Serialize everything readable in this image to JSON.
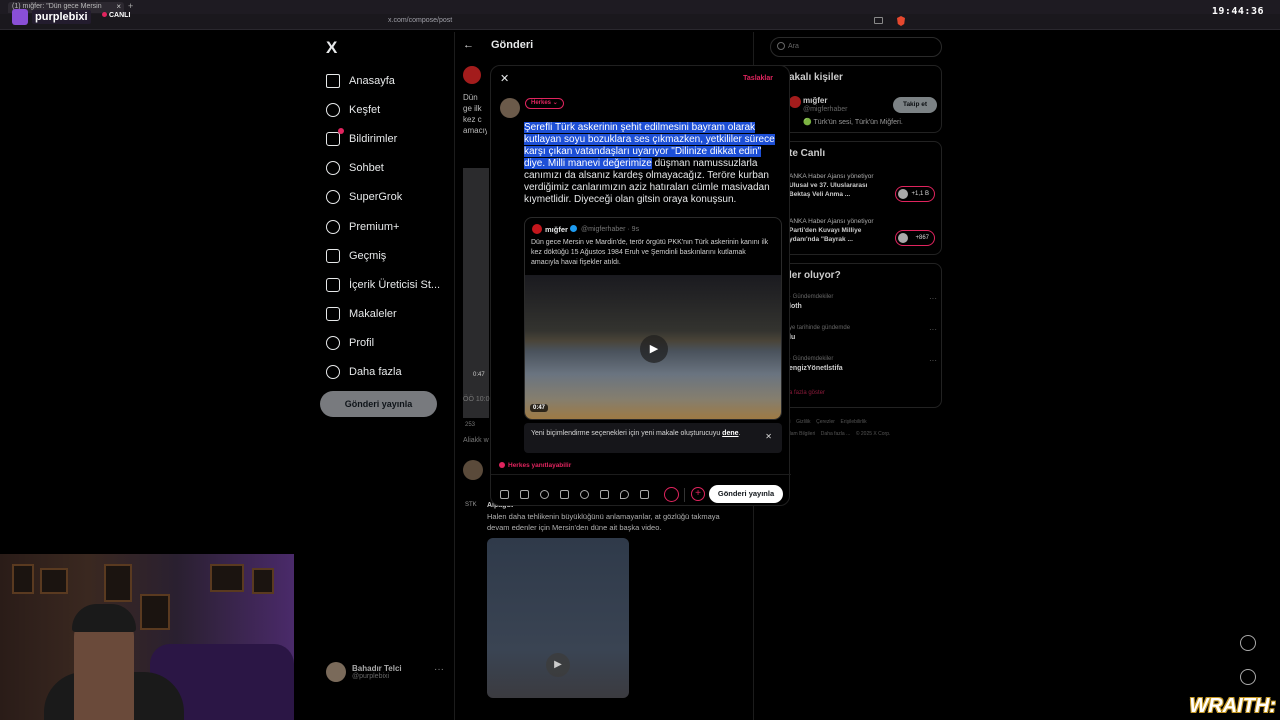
{
  "browser": {
    "tab_title": "(1) mığfer: \"Dün gece Mersin",
    "url": "x.com/compose/post",
    "clock": "19:44:36"
  },
  "overlay": {
    "brand": "purplebixi",
    "live": "CANLI",
    "wraith": "WRAITH:"
  },
  "nav": {
    "items": [
      {
        "label": "Anasayfa",
        "icon": "home-icon"
      },
      {
        "label": "Keşfet",
        "icon": "search-icon"
      },
      {
        "label": "Bildirimler",
        "icon": "bell-icon"
      },
      {
        "label": "Sohbet",
        "icon": "chat-icon"
      },
      {
        "label": "SuperGrok",
        "icon": "grok-icon"
      },
      {
        "label": "Premium+",
        "icon": "premium-icon"
      },
      {
        "label": "Geçmiş",
        "icon": "bookmark-icon"
      },
      {
        "label": "İçerik Üreticisi St...",
        "icon": "creator-icon"
      },
      {
        "label": "Makaleler",
        "icon": "articles-icon"
      },
      {
        "label": "Profil",
        "icon": "profile-icon"
      },
      {
        "label": "Daha fazla",
        "icon": "more-icon"
      }
    ],
    "post_button": "Gönderi yayınla"
  },
  "profile": {
    "name": "Bahadır Telci",
    "handle": "@purplebixi",
    "more": "···"
  },
  "center": {
    "title": "Gönderi",
    "feed_text": "Dün ge ilk kez c amacıy",
    "feed_duration": "0:47",
    "feed_time": "ÖÖ 10:0",
    "feed_stats": "253",
    "feed_aka": "Aliakk w",
    "reply_author": "Alpagut",
    "reply_av_label": "STK",
    "reply_text": "Halen daha tehlikenin büyüklüğünü anlamayanlar, at gözlüğü takmaya devam edenler için Mersin'den düne ait başka video."
  },
  "right": {
    "search_placeholder": "Ara",
    "who_to_follow_title": "akalı kişiler",
    "suggestion": {
      "name": "mığfer",
      "handle": "@migferhaber",
      "bio": "🟢 Türk'ün sesi, Türk'ün Miğferi.",
      "follow": "Takip et"
    },
    "live_title": "te Canlı",
    "live_items": [
      {
        "source": "ANKA Haber Ajansı",
        "suffix": "yönetiyor",
        "title": "Ulusal ve 37. Uluslararası Bektaş Veli Anma ...",
        "count": "+1,1 B"
      },
      {
        "source": "ANKA Haber Ajansı",
        "suffix": "yönetiyor",
        "title": "Parti'den Kuvayı Milliye ydanı'nda \"Bayrak ...",
        "count": "+867"
      }
    ],
    "trends_title": "ler oluyor?",
    "trends": [
      {
        "meta": "· Gündemdekiler",
        "name": "loth"
      },
      {
        "meta": "ye tarihinde gündemde",
        "name": "lu"
      },
      {
        "meta": "· Gündemdekiler",
        "name": "engizYönetlstifa"
      }
    ],
    "show_more": "a fazla göster",
    "footer": [
      "ti",
      "Gizlilik",
      "Çerezler",
      "Erişilebilirlik",
      "rlam Bilgileri",
      "Daha fazla ...",
      "© 2025 X Corp."
    ]
  },
  "modal": {
    "drafts": "Taslaklar",
    "audience": "Herkes",
    "text_selected": "Şerefli Türk askerinin şehit edilmesini bayram olarak kutlayan soyu bozuklara ses çıkmazken, yetkililer sürece karşı çıkan vatandaşları uyarıyor \"Dilinize dikkat edin\" diye. Milli manevi değerimize",
    "text_rest": " düşman namussuzlarla canımızı da alsanız kardeş olmayacağız.  Teröre kurban verdiğimiz canlarımızın aziz hatıraları cümle masivadan kıymetlidir. Diyeceği olan gitsin oraya konuşsun.",
    "quote": {
      "name": "mığfer",
      "handle": "@migferhaber · 9s",
      "text": "Dün gece Mersin ve Mardin'de, terör örgütü PKK'nın Türk askerinin kanını ilk kez döktüğü 15 Ağustos 1984 Eruh ve Şemdinli baskınlarını kutlamak amacıyla havai fişekler atıldı.",
      "duration": "0:47"
    },
    "notice_text": "Yeni biçimlendirme seçenekleri için yeni makale oluşturucuyu ",
    "notice_link": "dene",
    "notice_end": ".",
    "reply_setting": "Herkes yanıtlayabilir",
    "publish": "Gönderi yayınla"
  }
}
